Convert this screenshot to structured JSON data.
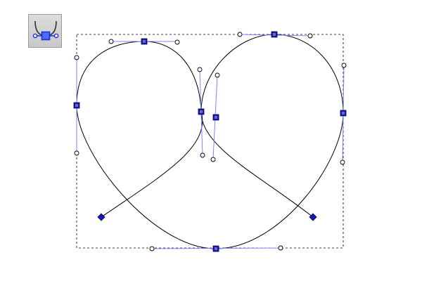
{
  "toolbar": {
    "tool": {
      "icon": "node-tool-icon",
      "active": true,
      "icon_color": "#1a2fd6"
    }
  },
  "canvas": {
    "path_stroke_color": "#000000",
    "node_color": "#1a1aa8",
    "handle_line_color": "#7f86ff",
    "bbox_color": "#000000",
    "endpoint_shape": "diamond",
    "node_shape": "square",
    "handle_shape": "circle"
  }
}
